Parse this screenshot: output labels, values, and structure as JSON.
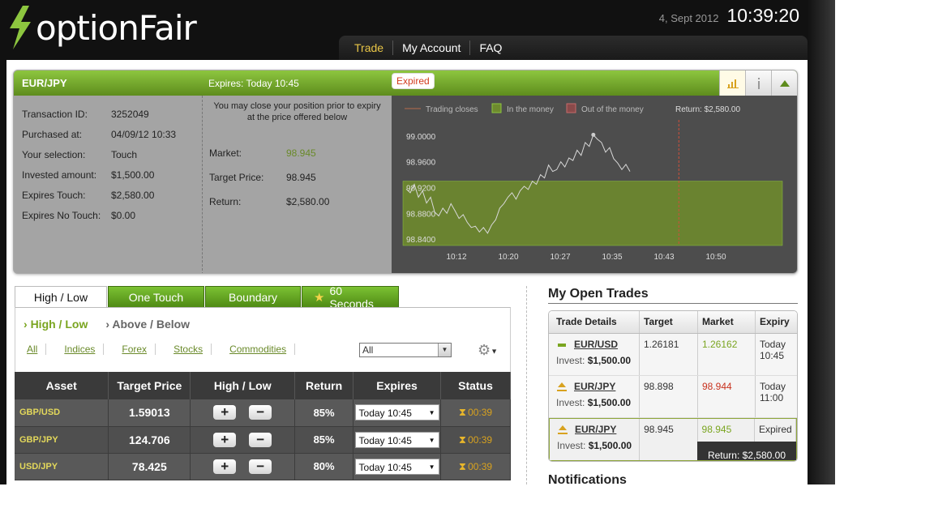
{
  "header": {
    "brand": "optionFair",
    "date": "4, Sept 2012",
    "time": "10:39:20",
    "nav": [
      "Trade",
      "My Account",
      "FAQ"
    ]
  },
  "expired_trade": {
    "pair": "EUR/JPY",
    "expires": "Expires:  Today 10:45",
    "badge": "Expired",
    "details": [
      {
        "label": "Transaction ID:",
        "value": "3252049"
      },
      {
        "label": "Purchased at:",
        "value": "04/09/12 10:33"
      },
      {
        "label": "Your selection:",
        "value": "Touch"
      },
      {
        "label": "Invested amount:",
        "value": "$1,500.00"
      },
      {
        "label": "Expires Touch:",
        "value": "$2,580.00"
      },
      {
        "label": "Expires No Touch:",
        "value": "$0.00"
      }
    ],
    "close_note": "You may close your position prior to expiry at the price offered below",
    "close": [
      {
        "label": "Market:",
        "value": "98.945"
      },
      {
        "label": "Target Price:",
        "value": "98.945"
      },
      {
        "label": "Return:",
        "value": "$2,580.00"
      }
    ],
    "legend": {
      "trading_closes": "Trading closes",
      "in_money": "In the money",
      "out_money": "Out of the money",
      "return": "Return: $2,580.00"
    }
  },
  "chart_data": {
    "type": "line",
    "x_ticks": [
      "10:12",
      "10:20",
      "10:27",
      "10:35",
      "10:43",
      "10:50"
    ],
    "y_ticks": [
      "99.0000",
      "98.9600",
      "98.9200",
      "98.8800",
      "98.8400"
    ],
    "ylim": [
      98.83,
      99.01
    ],
    "in_the_money_from": 98.93,
    "trading_closes_at": "10:45",
    "series": [
      {
        "values": [
          98.918,
          98.912,
          98.925,
          98.905,
          98.915,
          98.896,
          98.905,
          98.882,
          98.876,
          98.888,
          98.88,
          98.895,
          98.884,
          98.872,
          98.878,
          98.866,
          98.858,
          98.86,
          98.851,
          98.858,
          98.849,
          98.862,
          98.87,
          98.888,
          98.895,
          98.905,
          98.912,
          98.902,
          98.915,
          98.922,
          98.917,
          98.93,
          98.925,
          98.94,
          98.935,
          98.955,
          98.945,
          98.948,
          98.96,
          98.952,
          98.966,
          98.962,
          98.978,
          98.97,
          98.99,
          98.984,
          99.002,
          98.995,
          98.99,
          98.975,
          98.982,
          98.965,
          98.958,
          98.948,
          98.956,
          98.945
        ]
      }
    ]
  },
  "trade_tabs": [
    "High / Low",
    "One Touch",
    "Boundary",
    "60 Seconds"
  ],
  "sub_tabs": [
    "High / Low",
    "Above / Below"
  ],
  "filters": [
    "All",
    "Indices",
    "Forex",
    "Stocks",
    "Commodities"
  ],
  "filter_select": "All",
  "asset_table": {
    "headers": [
      "Asset",
      "Target Price",
      "High / Low",
      "Return",
      "Expires",
      "Status"
    ],
    "rows": [
      {
        "asset": "GBP/USD",
        "target": "1.59013",
        "ret": "85%",
        "expires": "Today 10:45",
        "status": "00:39"
      },
      {
        "asset": "GBP/JPY",
        "target": "124.706",
        "ret": "85%",
        "expires": "Today 10:45",
        "status": "00:39"
      },
      {
        "asset": "USD/JPY",
        "target": "78.425",
        "ret": "80%",
        "expires": "Today 10:45",
        "status": "00:39"
      }
    ]
  },
  "open_trades": {
    "title": "My Open Trades",
    "headers": [
      "Trade Details",
      "Target",
      "Market",
      "Expiry"
    ],
    "invest_label": "Invest:",
    "rows": [
      {
        "pair": "EUR/USD",
        "invest": "$1,500.00",
        "target": "1.26181",
        "market": "1.26162",
        "expiry": "Today 10:45"
      },
      {
        "pair": "EUR/JPY",
        "invest": "$1,500.00",
        "target": "98.898",
        "market": "98.944",
        "expiry": "Today 11:00"
      },
      {
        "pair": "EUR/JPY",
        "invest": "$1,500.00",
        "target": "98.945",
        "market": "98.945",
        "expiry": "Expired",
        "return": "Return: $2,580.00"
      }
    ]
  },
  "notifications_title": "Notifications",
  "colors": {
    "accent_green": "#7aa520",
    "brand_yellow": "#e8c547",
    "loss_red": "#c8321e"
  }
}
